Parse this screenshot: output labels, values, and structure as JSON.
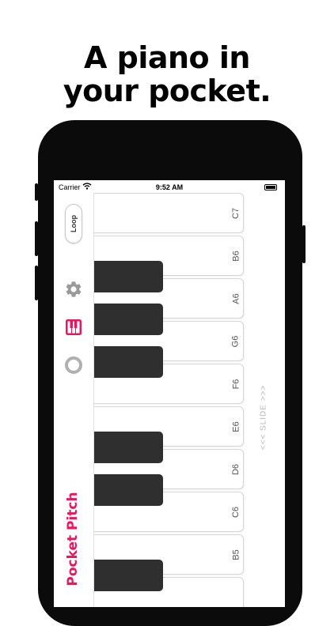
{
  "headline": {
    "line1": "A piano in",
    "line2": "your pocket."
  },
  "status_bar": {
    "carrier": "Carrier",
    "time": "9:52 AM"
  },
  "sidebar": {
    "loop_label": "Loop",
    "icons": [
      "gear-icon",
      "keyboard-icon",
      "ring-icon"
    ],
    "app_name": "Pocket Pitch",
    "app_name_color": "#e8185e"
  },
  "keyboard": {
    "white_keys": [
      "C7",
      "B6",
      "A6",
      "G6",
      "F6",
      "E6",
      "D6",
      "C6",
      "B5"
    ]
  },
  "slide_hint": "<<< SLIDE >>>",
  "colors": {
    "accent": "#e8185e",
    "black_key": "#2f2f2f",
    "phone": "#0b0b0b"
  }
}
